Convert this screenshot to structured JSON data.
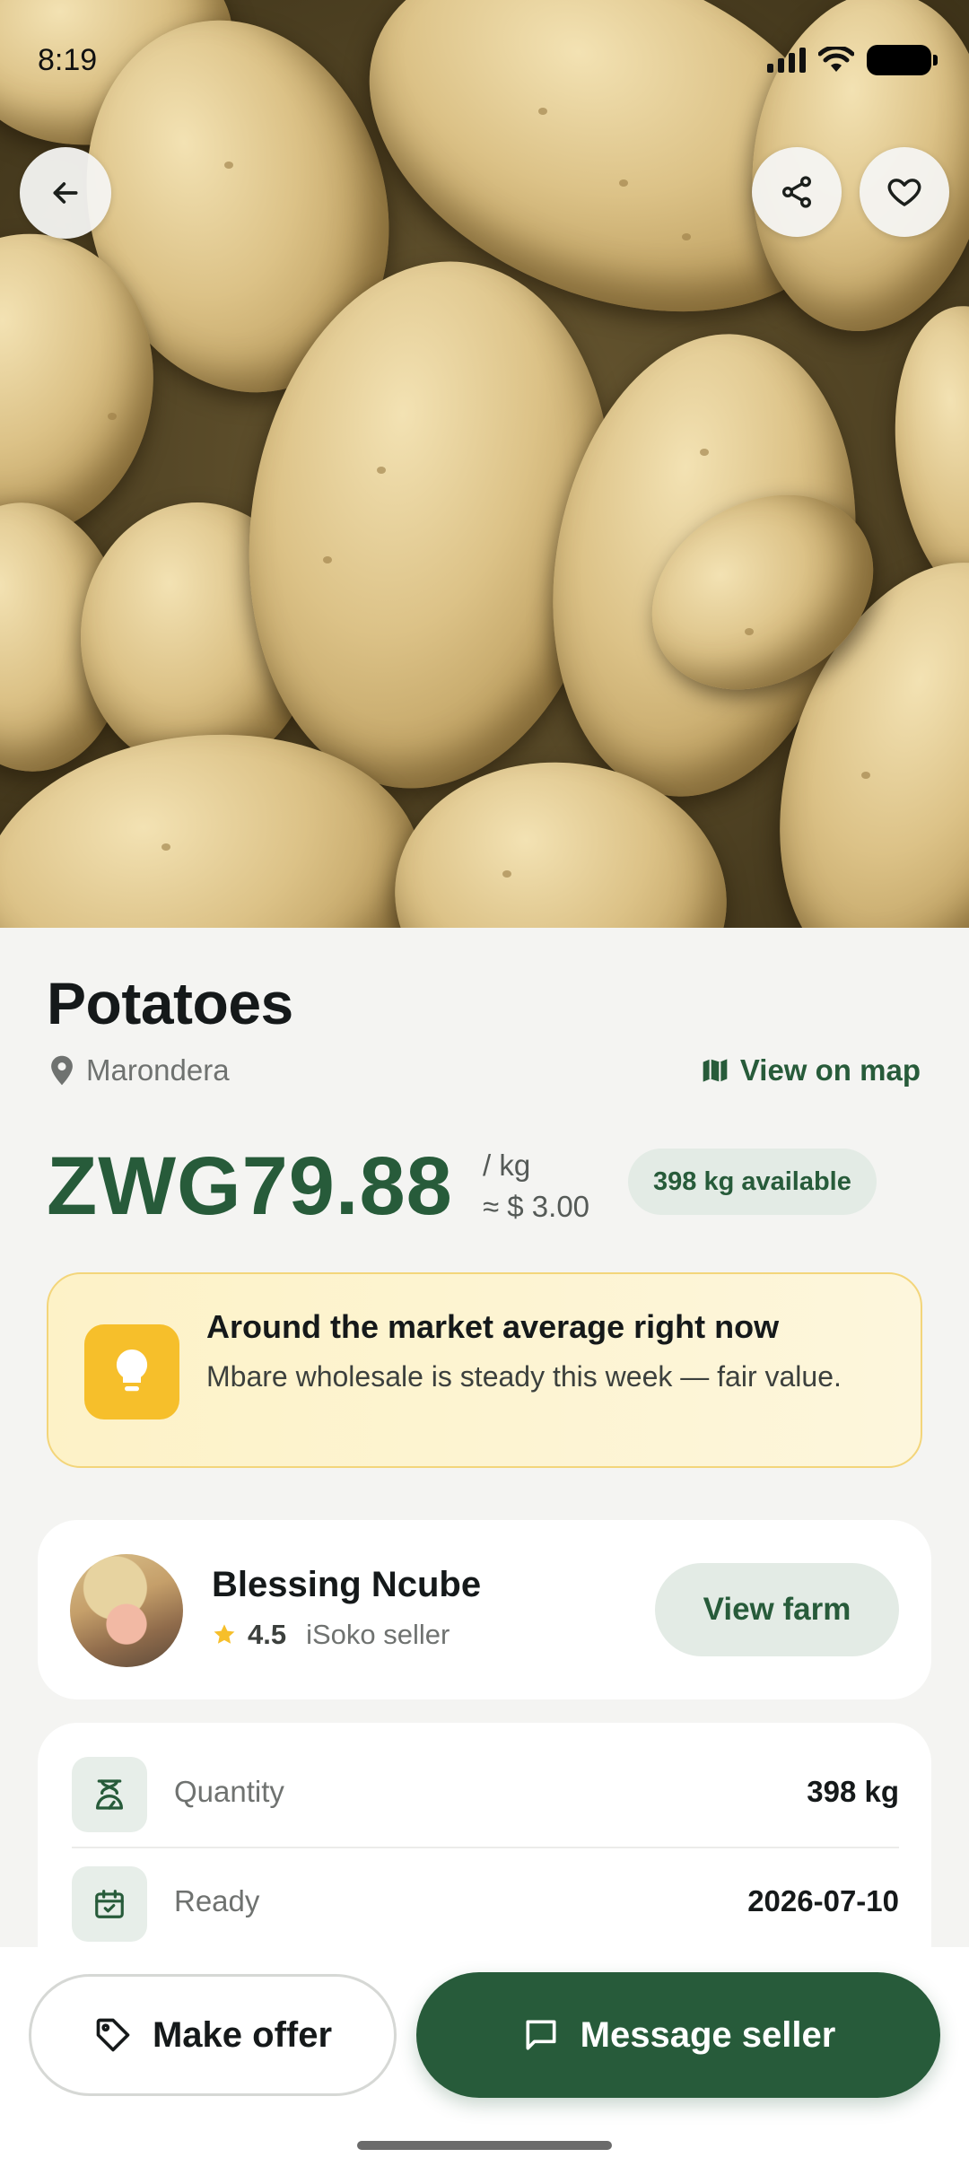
{
  "status_bar": {
    "time": "8:19"
  },
  "hero": {
    "image_name": "potatoes-photo"
  },
  "product": {
    "title": "Potatoes",
    "location": "Marondera",
    "map_link": "View on map",
    "price": "ZWG79.88",
    "unit": "/ kg",
    "usd_equiv": "≈ $ 3.00",
    "available": "398 kg available"
  },
  "tip": {
    "title": "Around the market average right now",
    "body": "Mbare wholesale is steady this week — fair value."
  },
  "seller": {
    "name": "Blessing Ncube",
    "rating": "4.5",
    "role": "iSoko seller",
    "view_farm": "View farm"
  },
  "details": [
    {
      "label": "Quantity",
      "value": "398 kg"
    },
    {
      "label": "Ready",
      "value": "2026-07-10"
    }
  ],
  "actions": {
    "make_offer": "Make offer",
    "message_seller": "Message seller"
  },
  "colors": {
    "brand_green": "#275b3a",
    "tip_yellow": "#f6bf2b",
    "background": "#f4f4f2"
  }
}
